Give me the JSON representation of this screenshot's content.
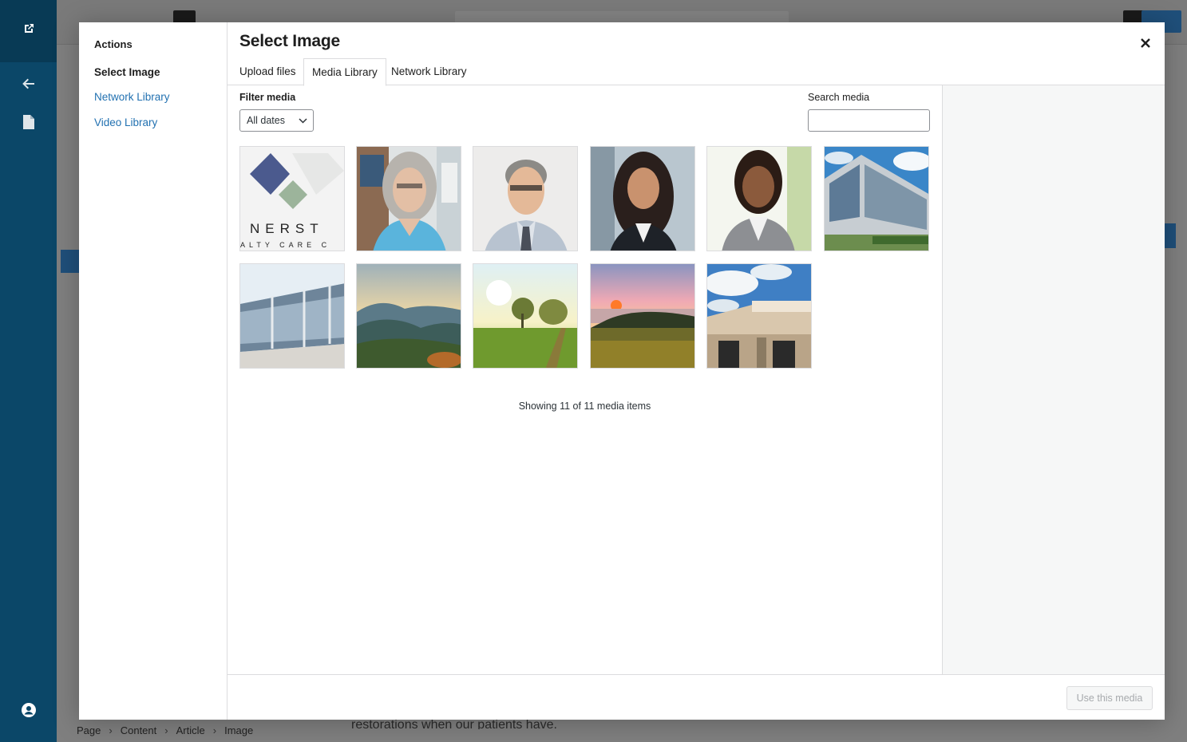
{
  "background": {
    "breadcrumbs": [
      "Page",
      "Content",
      "Article",
      "Image"
    ],
    "breadcrumb_separator": "›",
    "partial_text": "restorations when our patients have."
  },
  "modal": {
    "menu": {
      "heading": "Actions",
      "items": [
        {
          "label": "Select Image",
          "active": true
        },
        {
          "label": "Network Library",
          "active": false
        },
        {
          "label": "Video Library",
          "active": false
        }
      ]
    },
    "title": "Select Image",
    "close_icon": "close-icon",
    "tabs": [
      {
        "label": "Upload files",
        "active": false
      },
      {
        "label": "Media Library",
        "active": true
      },
      {
        "label": "Network Library",
        "active": false
      }
    ],
    "filter": {
      "label": "Filter media",
      "selected": "All dates"
    },
    "search": {
      "label": "Search media",
      "value": ""
    },
    "media_items": [
      "logo",
      "woman-gray-hair",
      "man-glasses",
      "woman-dark-hair",
      "woman-smiling",
      "office-building",
      "glass-building",
      "mountain-valley",
      "sunny-meadow",
      "sunset-field",
      "storefront"
    ],
    "count_text": "Showing 11 of 11 media items",
    "logo_text": {
      "line1": "NERST",
      "line2": "ALTY CARE C"
    },
    "use_button": "Use this media"
  },
  "colors": {
    "sidebar": "#0b4768",
    "link": "#2271b1",
    "accent": "#1f4f7a"
  }
}
